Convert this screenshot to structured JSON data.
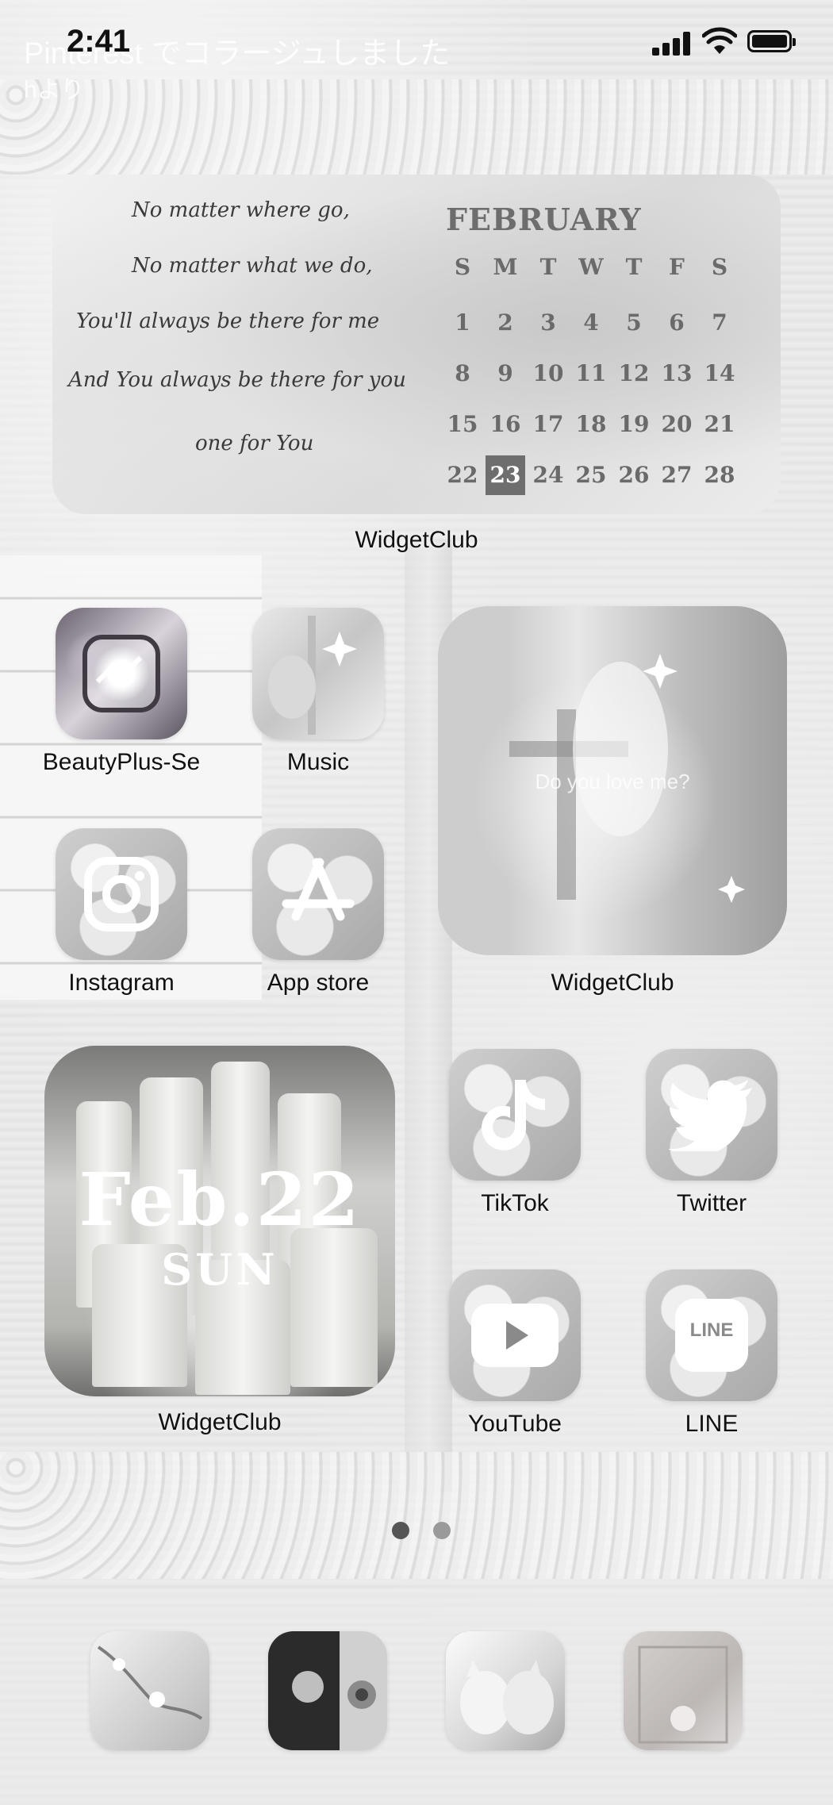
{
  "status_bar": {
    "time": "2:41",
    "notification_title": "Pinterest でコラージュしました",
    "notification_subtitle": "hより",
    "battery_level": 1.0
  },
  "calendar_widget": {
    "month": "FEBRUARY",
    "weekdays": [
      "S",
      "M",
      "T",
      "W",
      "T",
      "F",
      "S"
    ],
    "weeks": [
      [
        "1",
        "2",
        "3",
        "4",
        "5",
        "6",
        "7"
      ],
      [
        "8",
        "9",
        "10",
        "11",
        "12",
        "13",
        "14"
      ],
      [
        "15",
        "16",
        "17",
        "18",
        "19",
        "20",
        "21"
      ],
      [
        "22",
        "23",
        "24",
        "25",
        "26",
        "27",
        "28"
      ]
    ],
    "highlighted_day": "23",
    "script_lines": [
      "No matter where go,",
      "No matter what we do,",
      "You'll always be there for me",
      "And You always be there for you",
      "one for You"
    ],
    "label": "WidgetClub"
  },
  "apps": {
    "beautyplus": {
      "label": "BeautyPlus-Se",
      "icon": "crystal-cube-icon"
    },
    "music": {
      "label": "Music",
      "icon": "photo-icon"
    },
    "instagram": {
      "label": "Instagram",
      "icon": "instagram-icon"
    },
    "app_store": {
      "label": "App store",
      "icon": "app-store-icon"
    },
    "tiktok": {
      "label": "TikTok",
      "icon": "tiktok-icon"
    },
    "twitter": {
      "label": "Twitter",
      "icon": "twitter-bird-icon"
    },
    "youtube": {
      "label": "YouTube",
      "icon": "youtube-play-icon"
    },
    "line": {
      "label": "LINE",
      "icon": "line-icon",
      "badge_text": "LINE"
    }
  },
  "photo_widget": {
    "overlay_text": "Do you love me?",
    "label": "WidgetClub"
  },
  "candle_widget": {
    "date": "Feb.22",
    "day": "SUN",
    "label": "WidgetClub"
  },
  "page_indicator": {
    "pages": 2,
    "current": 1,
    "active_color": "#555555",
    "inactive_color": "#9a9a9a"
  },
  "dock": {
    "apps": [
      "flower-branch-photo-icon",
      "camera-photo-icon",
      "kittens-photo-icon",
      "chandelier-photo-icon"
    ]
  }
}
